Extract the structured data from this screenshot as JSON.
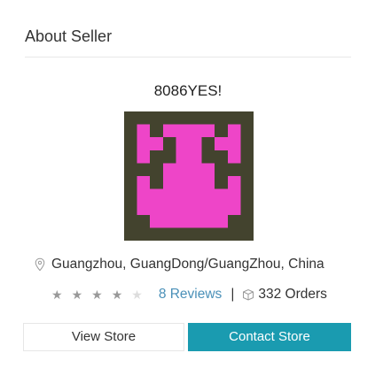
{
  "section": {
    "title": "About Seller"
  },
  "seller": {
    "name": "8086YES!",
    "location": "Guangzhou, GuangDong/GuangZhou, China",
    "rating_stars": 4,
    "rating_max": 5,
    "reviews_label": "8 Reviews",
    "separator": "|",
    "orders_label": "332 Orders"
  },
  "avatar": {
    "background_color": "#43432e",
    "pattern_color": "#ee45c8"
  },
  "buttons": {
    "view_store": "View Store",
    "contact_store": "Contact Store"
  },
  "icons": {
    "location": "map-pin-icon",
    "star": "star-icon",
    "orders": "box-icon"
  },
  "colors": {
    "accent": "#1a9bb0",
    "link": "#4a90b8",
    "star_filled": "#999999",
    "star_empty": "#dddddd"
  }
}
